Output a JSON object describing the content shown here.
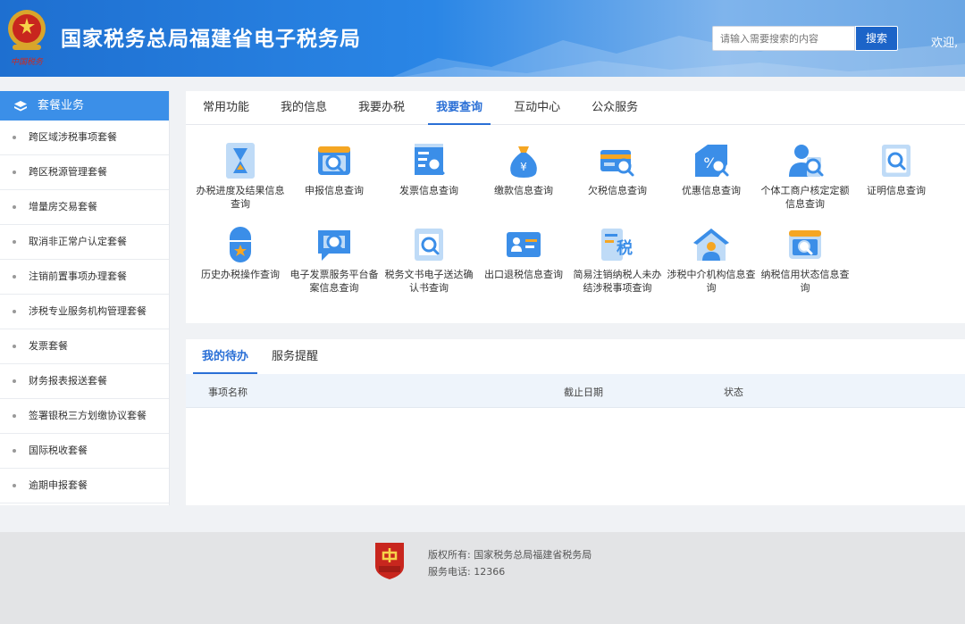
{
  "header": {
    "title": "国家税务总局福建省电子税务局",
    "search_placeholder": "请输入需要搜索的内容",
    "search_button": "搜索",
    "welcome": "欢迎,"
  },
  "sidebar": {
    "heading": "套餐业务",
    "items": [
      {
        "label": "跨区域涉税事项套餐"
      },
      {
        "label": "跨区税源管理套餐"
      },
      {
        "label": "增量房交易套餐"
      },
      {
        "label": "取消非正常户认定套餐"
      },
      {
        "label": "注销前置事项办理套餐"
      },
      {
        "label": "涉税专业服务机构管理套餐"
      },
      {
        "label": "发票套餐"
      },
      {
        "label": "财务报表报送套餐"
      },
      {
        "label": "签署银税三方划缴协议套餐"
      },
      {
        "label": "国际税收套餐"
      },
      {
        "label": "逾期申报套餐"
      }
    ]
  },
  "main": {
    "tabs": [
      {
        "label": "常用功能"
      },
      {
        "label": "我的信息"
      },
      {
        "label": "我要办税"
      },
      {
        "label": "我要查询",
        "active": true
      },
      {
        "label": "互动中心"
      },
      {
        "label": "公众服务"
      }
    ],
    "tiles": [
      {
        "label": "办税进度及结果信息查询",
        "icon": "hourglass-icon"
      },
      {
        "label": "申报信息查询",
        "icon": "browser-search-icon"
      },
      {
        "label": "发票信息查询",
        "icon": "invoice-search-icon"
      },
      {
        "label": "缴款信息查询",
        "icon": "money-bag-icon"
      },
      {
        "label": "欠税信息查询",
        "icon": "card-search-icon"
      },
      {
        "label": "优惠信息查询",
        "icon": "discount-tag-icon"
      },
      {
        "label": "个体工商户核定定额信息查询",
        "icon": "person-search-icon"
      },
      {
        "label": "证明信息查询",
        "icon": "certificate-search-icon"
      },
      {
        "label": "历史办税操作查询",
        "icon": "mouse-star-icon"
      },
      {
        "label": "电子发票服务平台备案信息查询",
        "icon": "chat-search-icon"
      },
      {
        "label": "税务文书电子送达确认书查询",
        "icon": "document-search-icon"
      },
      {
        "label": "出口退税信息查询",
        "icon": "id-card-icon"
      },
      {
        "label": "简易注销纳税人未办结涉税事项查询",
        "icon": "tax-document-icon"
      },
      {
        "label": "涉税中介机构信息查询",
        "icon": "house-person-icon"
      },
      {
        "label": "纳税信用状态信息查询",
        "icon": "window-search-icon"
      }
    ]
  },
  "todo": {
    "tabs": [
      {
        "label": "我的待办",
        "active": true
      },
      {
        "label": "服务提醒"
      }
    ],
    "columns": [
      "事项名称",
      "截止日期",
      "状态"
    ]
  },
  "footer": {
    "copyright": "版权所有: 国家税务总局福建省税务局",
    "phone": "服务电话: 12366",
    "badge_text": "党政机关"
  },
  "colors": {
    "header_blue": "#1e6fd0",
    "accent": "#2a6fd6",
    "icon_blue": "#3b8ee8",
    "icon_light": "#bfdbf7",
    "icon_orange": "#f5a623"
  }
}
